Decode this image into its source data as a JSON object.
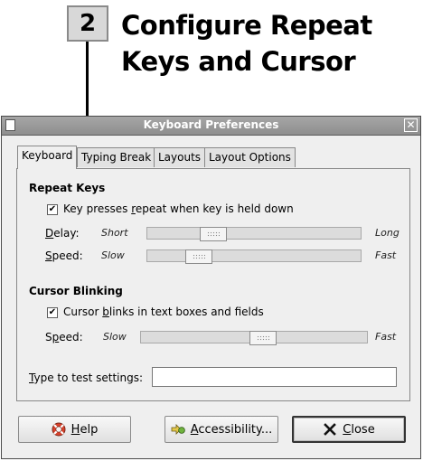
{
  "callout": {
    "step_number": "2",
    "title_line1": "Configure Repeat",
    "title_line2": "Keys and Cursor"
  },
  "window": {
    "title": "Keyboard Preferences",
    "close_glyph": "✕"
  },
  "tabs": [
    {
      "label": "Keyboard",
      "active": true
    },
    {
      "label": "Typing Break",
      "active": false
    },
    {
      "label": "Layouts",
      "active": false
    },
    {
      "label": "Layout Options",
      "active": false
    }
  ],
  "repeat_keys": {
    "heading": "Repeat Keys",
    "checkbox_pre": "Key presses ",
    "checkbox_mnemonic": "r",
    "checkbox_post": "epeat when key is held down",
    "checked": true,
    "delay": {
      "label_mnemonic": "D",
      "label_rest": "elay:",
      "min_label": "Short",
      "max_label": "Long",
      "value": 0.31
    },
    "speed": {
      "label_mnemonic": "S",
      "label_rest": "peed:",
      "min_label": "Slow",
      "max_label": "Fast",
      "value": 0.24
    }
  },
  "cursor_blinking": {
    "heading": "Cursor Blinking",
    "checkbox_pre": "Cursor ",
    "checkbox_mnemonic": "b",
    "checkbox_post": "links in text boxes and fields",
    "checked": true,
    "speed": {
      "label_pre": "S",
      "label_mnemonic": "p",
      "label_rest": "eed:",
      "min_label": "Slow",
      "max_label": "Fast",
      "value": 0.54
    }
  },
  "test_field": {
    "label_mnemonic": "T",
    "label_rest": "ype to test settings:",
    "value": ""
  },
  "buttons": {
    "help": {
      "mnemonic": "H",
      "rest": "elp",
      "icon": "lifebuoy-icon"
    },
    "accessibility": {
      "mnemonic": "A",
      "rest": "ccessibility...",
      "icon": "accessibility-icon"
    },
    "close": {
      "mnemonic": "C",
      "rest": "lose",
      "icon": "close-x-icon"
    }
  }
}
